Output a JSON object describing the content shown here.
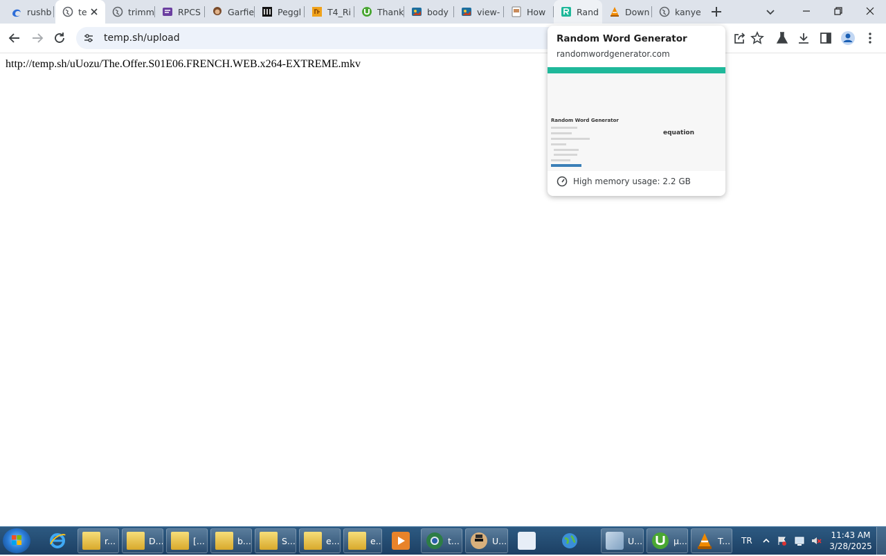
{
  "browser": {
    "tabs": [
      {
        "title": "rushb",
        "favicon": "edge-icon",
        "state": "normal"
      },
      {
        "title": "te",
        "favicon": "globe-icon",
        "state": "active"
      },
      {
        "title": "trimm",
        "favicon": "globe-icon",
        "state": "normal"
      },
      {
        "title": "RPCS",
        "favicon": "doc-icon",
        "state": "normal"
      },
      {
        "title": "Garfie",
        "favicon": "avatar-icon",
        "state": "normal"
      },
      {
        "title": "Peggl",
        "favicon": "pillars-icon",
        "state": "normal"
      },
      {
        "title": "T4_Ri",
        "favicon": "jfk-icon",
        "state": "normal"
      },
      {
        "title": "Thank",
        "favicon": "utorrent-icon",
        "state": "normal"
      },
      {
        "title": "body",
        "favicon": "image-icon",
        "state": "normal"
      },
      {
        "title": "view-",
        "favicon": "image-icon",
        "state": "normal"
      },
      {
        "title": "How",
        "favicon": "page-icon",
        "state": "normal"
      },
      {
        "title": "Rand",
        "favicon": "r-icon",
        "state": "hovered"
      },
      {
        "title": "Down",
        "favicon": "vlc-icon",
        "state": "normal"
      },
      {
        "title": "kanye",
        "favicon": "globe-icon",
        "state": "normal"
      }
    ],
    "address_bar": {
      "url": "temp.sh/upload"
    }
  },
  "page": {
    "link_text": "http://temp.sh/uUozu/The.Offer.S01E06.FRENCH.WEB.x264-EXTREME.mkv"
  },
  "hover_card": {
    "title": "Random Word Generator",
    "domain": "randomwordgenerator.com",
    "preview_title": "Random Word Generator",
    "preview_word": "equation",
    "memory": "High memory usage: 2.2 GB"
  },
  "taskbar": {
    "items": [
      {
        "label": "r...",
        "icon": "folder-icon"
      },
      {
        "label": "D...",
        "icon": "folder-icon"
      },
      {
        "label": "[...",
        "icon": "folder-icon"
      },
      {
        "label": "b...",
        "icon": "folder-icon"
      },
      {
        "label": "S...",
        "icon": "folder-icon"
      },
      {
        "label": "e...",
        "icon": "folder-icon"
      },
      {
        "label": "e...",
        "icon": "folder-icon"
      },
      {
        "label": "t...",
        "icon": "chrome-icon"
      },
      {
        "label": "U...",
        "icon": "user-icon"
      },
      {
        "label": "U...",
        "icon": "utorrent-icon"
      },
      {
        "label": "µ...",
        "icon": "utorrent-icon"
      },
      {
        "label": "T...",
        "icon": "vlc-icon"
      }
    ],
    "language": "TR",
    "time": "11:43 AM",
    "date": "3/28/2025"
  },
  "colors": {
    "tabstrip": "#dee3eb",
    "omnibox": "#edf2fa",
    "preview_accent": "#1fb89a",
    "taskbar": "#1c3f63"
  }
}
